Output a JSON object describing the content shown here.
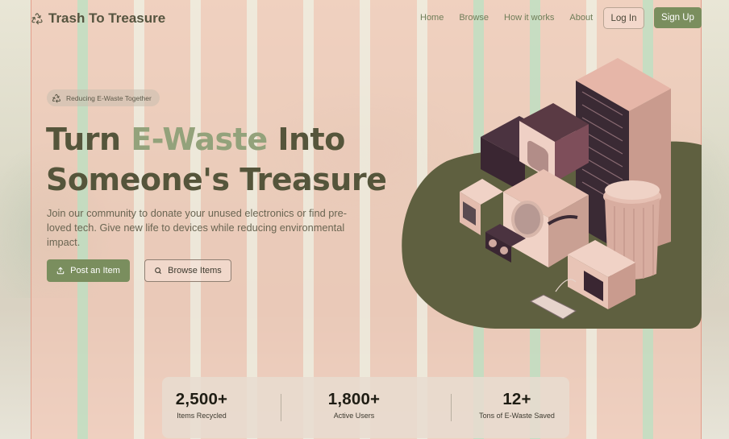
{
  "brand": {
    "name": "Trash To Treasure",
    "icon": "recycle-icon"
  },
  "nav": {
    "items": [
      "Home",
      "Browse",
      "How it works",
      "About"
    ]
  },
  "auth": {
    "login": "Log In",
    "signup": "Sign Up"
  },
  "hero": {
    "badge": "Reducing E-Waste Together",
    "title_part1": "Turn ",
    "title_accent": "E-Waste",
    "title_part2": " Into",
    "title_line2": "Someone's Treasure",
    "subtitle": "Join our community to donate your unused electronics or find pre-loved tech. Give new life to devices while reducing environmental impact.",
    "primary_cta": "Post an Item",
    "secondary_cta": "Browse Items"
  },
  "stats": [
    {
      "value": "2,500+",
      "label": "Items Recycled"
    },
    {
      "value": "1,800+",
      "label": "Active Users"
    },
    {
      "value": "12+",
      "label": "Tons of E-Waste Saved"
    }
  ],
  "colors": {
    "accent": "#7a8e5e",
    "accent_light": "#93a27b",
    "heading": "#55553b",
    "illustration_base": "#5f6040"
  }
}
